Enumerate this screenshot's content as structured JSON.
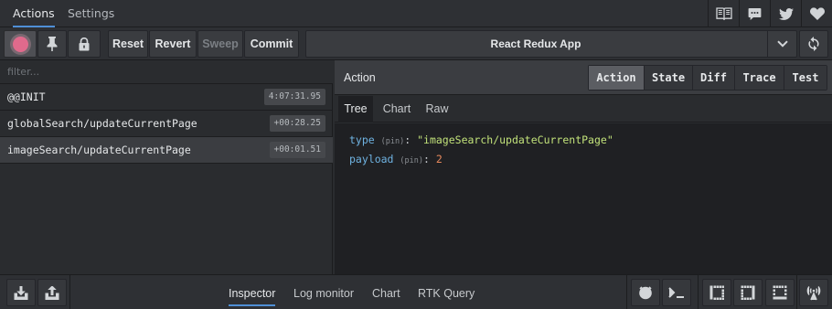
{
  "top_tabs": [
    {
      "label": "Actions",
      "active": true
    },
    {
      "label": "Settings",
      "active": false
    }
  ],
  "top_icons": [
    "docs-icon",
    "chat-icon",
    "twitter-icon",
    "heart-icon"
  ],
  "toolbar": {
    "record_color": "#e06a8c",
    "reset_label": "Reset",
    "revert_label": "Revert",
    "sweep_label": "Sweep",
    "commit_label": "Commit",
    "app_name": "React Redux App"
  },
  "filter": {
    "placeholder": "filter..."
  },
  "actions": [
    {
      "name": "@@INIT",
      "time": "4:07:31.95",
      "selected": false
    },
    {
      "name": "globalSearch/updateCurrentPage",
      "time": "+00:28.25",
      "selected": false
    },
    {
      "name": "imageSearch/updateCurrentPage",
      "time": "+00:01.51",
      "selected": true
    }
  ],
  "inspector": {
    "title": "Action",
    "modes": [
      "Action",
      "State",
      "Diff",
      "Trace",
      "Test"
    ],
    "active_mode": "Action",
    "subtabs": [
      "Tree",
      "Chart",
      "Raw"
    ],
    "active_subtab": "Tree",
    "tree": [
      {
        "key": "type",
        "pin": "(pin)",
        "colon": ":",
        "value": "\"imageSearch/updateCurrentPage\"",
        "value_type": "string"
      },
      {
        "key": "payload",
        "pin": "(pin)",
        "colon": ":",
        "value": "2",
        "value_type": "number"
      }
    ]
  },
  "bottom": {
    "tabs": [
      "Inspector",
      "Log monitor",
      "Chart",
      "RTK Query"
    ],
    "active_tab": "Inspector"
  },
  "colors": {
    "accent": "#4f8fd6",
    "key": "#6fb3e2",
    "string": "#c2e27a",
    "number": "#e8895c"
  }
}
